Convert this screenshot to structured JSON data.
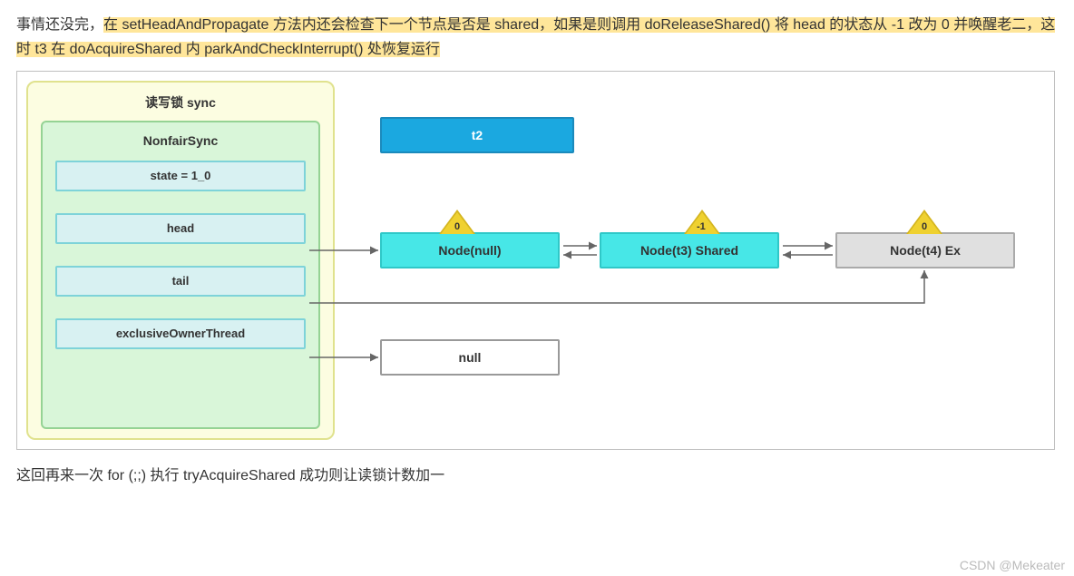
{
  "para1": {
    "pre": "事情还没完，",
    "hl": "在 setHeadAndPropagate 方法内还会检查下一个节点是否是 shared，如果是则调用 doReleaseShared() 将 head 的状态从 -1 改为 0 并唤醒老二，这时 t3 在 doAcquireShared 内 parkAndCheckInterrupt() 处恢复运行"
  },
  "syncTitle": "读写锁 sync",
  "nonfairTitle": "NonfairSync",
  "fields": {
    "state": "state = 1_0",
    "head": "head",
    "tail": "tail",
    "eot": "exclusiveOwnerThread"
  },
  "t2": "t2",
  "nodes": {
    "null": "Node(null)",
    "t3": "Node(t3) Shared",
    "t4": "Node(t4) Ex",
    "free": "null"
  },
  "badges": {
    "b1": "0",
    "b2": "-1",
    "b3": "0"
  },
  "para2": "这回再来一次 for (;;) 执行 tryAcquireShared 成功则让读锁计数加一",
  "watermark": "CSDN @Mekeater"
}
